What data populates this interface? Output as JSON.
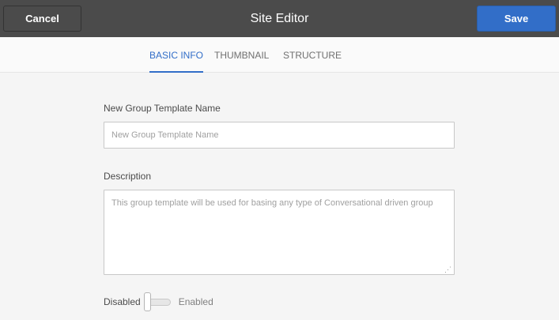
{
  "header": {
    "title": "Site Editor",
    "cancel_label": "Cancel",
    "save_label": "Save"
  },
  "tabs": [
    {
      "label": "BASIC INFO",
      "active": true
    },
    {
      "label": "THUMBNAIL",
      "active": false
    },
    {
      "label": "STRUCTURE",
      "active": false
    }
  ],
  "form": {
    "name": {
      "label": "New Group Template Name",
      "placeholder": "New Group Template Name",
      "value": ""
    },
    "description": {
      "label": "Description",
      "placeholder": "This group template will be used for basing any type of Conversational driven group",
      "value": ""
    },
    "toggle": {
      "off_label": "Disabled",
      "on_label": "Enabled",
      "enabled": false
    }
  },
  "colors": {
    "header_bg": "#4b4b4b",
    "accent": "#326ec8",
    "page_bg": "#f5f5f5"
  }
}
